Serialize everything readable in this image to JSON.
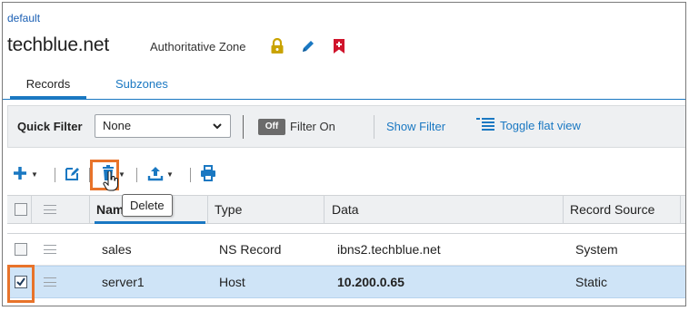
{
  "breadcrumb": "default",
  "zone": {
    "name": "techblue.net",
    "type": "Authoritative Zone"
  },
  "tabs": [
    {
      "label": "Records",
      "active": true
    },
    {
      "label": "Subzones",
      "active": false
    }
  ],
  "filter": {
    "quick_filter_label": "Quick Filter",
    "quick_filter_value": "None",
    "off_label": "Off",
    "filter_on_label": "Filter On",
    "show_filter_label": "Show Filter",
    "toggle_flat_view_label": "Toggle flat view"
  },
  "toolbar": {
    "tooltip": "Delete"
  },
  "table": {
    "columns": [
      "Name",
      "Type",
      "Data",
      "Record Source"
    ],
    "rows": [
      {
        "name": "sales",
        "type": "NS Record",
        "data": "ibns2.techblue.net",
        "source": "System",
        "checked": false,
        "selected": false
      },
      {
        "name": "server1",
        "type": "Host",
        "data": "10.200.0.65",
        "source": "Static",
        "checked": true,
        "selected": true
      }
    ]
  },
  "colors": {
    "accent": "#1a78c2",
    "highlight": "#e8732a",
    "lock": "#c9a300",
    "bookmark": "#d0142c",
    "selected_row": "#cfe4f7"
  }
}
